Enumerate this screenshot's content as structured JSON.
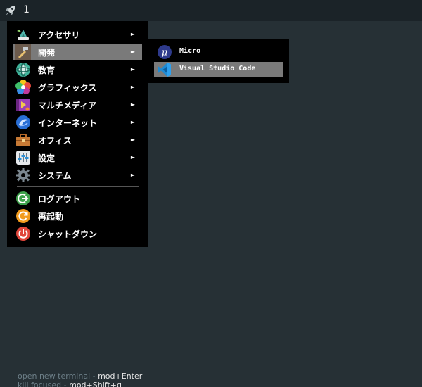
{
  "topbar": {
    "workspace": "1",
    "launcher_icon": "rocket-icon"
  },
  "menu": {
    "items": [
      {
        "label": "アクセサリ",
        "icon": "accessories-icon",
        "has_submenu": true
      },
      {
        "label": "開発",
        "icon": "development-icon",
        "has_submenu": true,
        "active": true
      },
      {
        "label": "教育",
        "icon": "education-icon",
        "has_submenu": true
      },
      {
        "label": "グラフィックス",
        "icon": "graphics-icon",
        "has_submenu": true
      },
      {
        "label": "マルチメディア",
        "icon": "multimedia-icon",
        "has_submenu": true
      },
      {
        "label": "インターネット",
        "icon": "internet-icon",
        "has_submenu": true
      },
      {
        "label": "オフィス",
        "icon": "office-icon",
        "has_submenu": true
      },
      {
        "label": "設定",
        "icon": "settings-icon",
        "has_submenu": true
      },
      {
        "label": "システム",
        "icon": "system-icon",
        "has_submenu": true
      }
    ],
    "actions": [
      {
        "label": "ログアウト",
        "icon": "logout-icon"
      },
      {
        "label": "再起動",
        "icon": "reboot-icon"
      },
      {
        "label": "シャットダウン",
        "icon": "shutdown-icon"
      }
    ],
    "arrow": "►"
  },
  "submenu": {
    "items": [
      {
        "label": "Micro",
        "icon": "micro-icon"
      },
      {
        "label": "Visual Studio Code",
        "icon": "vscode-icon",
        "active": true
      }
    ]
  },
  "hints": [
    {
      "text": "open new terminal - ",
      "keys": "mod+Enter"
    },
    {
      "text": "kill focused - ",
      "keys": "mod+Shift+q"
    }
  ]
}
